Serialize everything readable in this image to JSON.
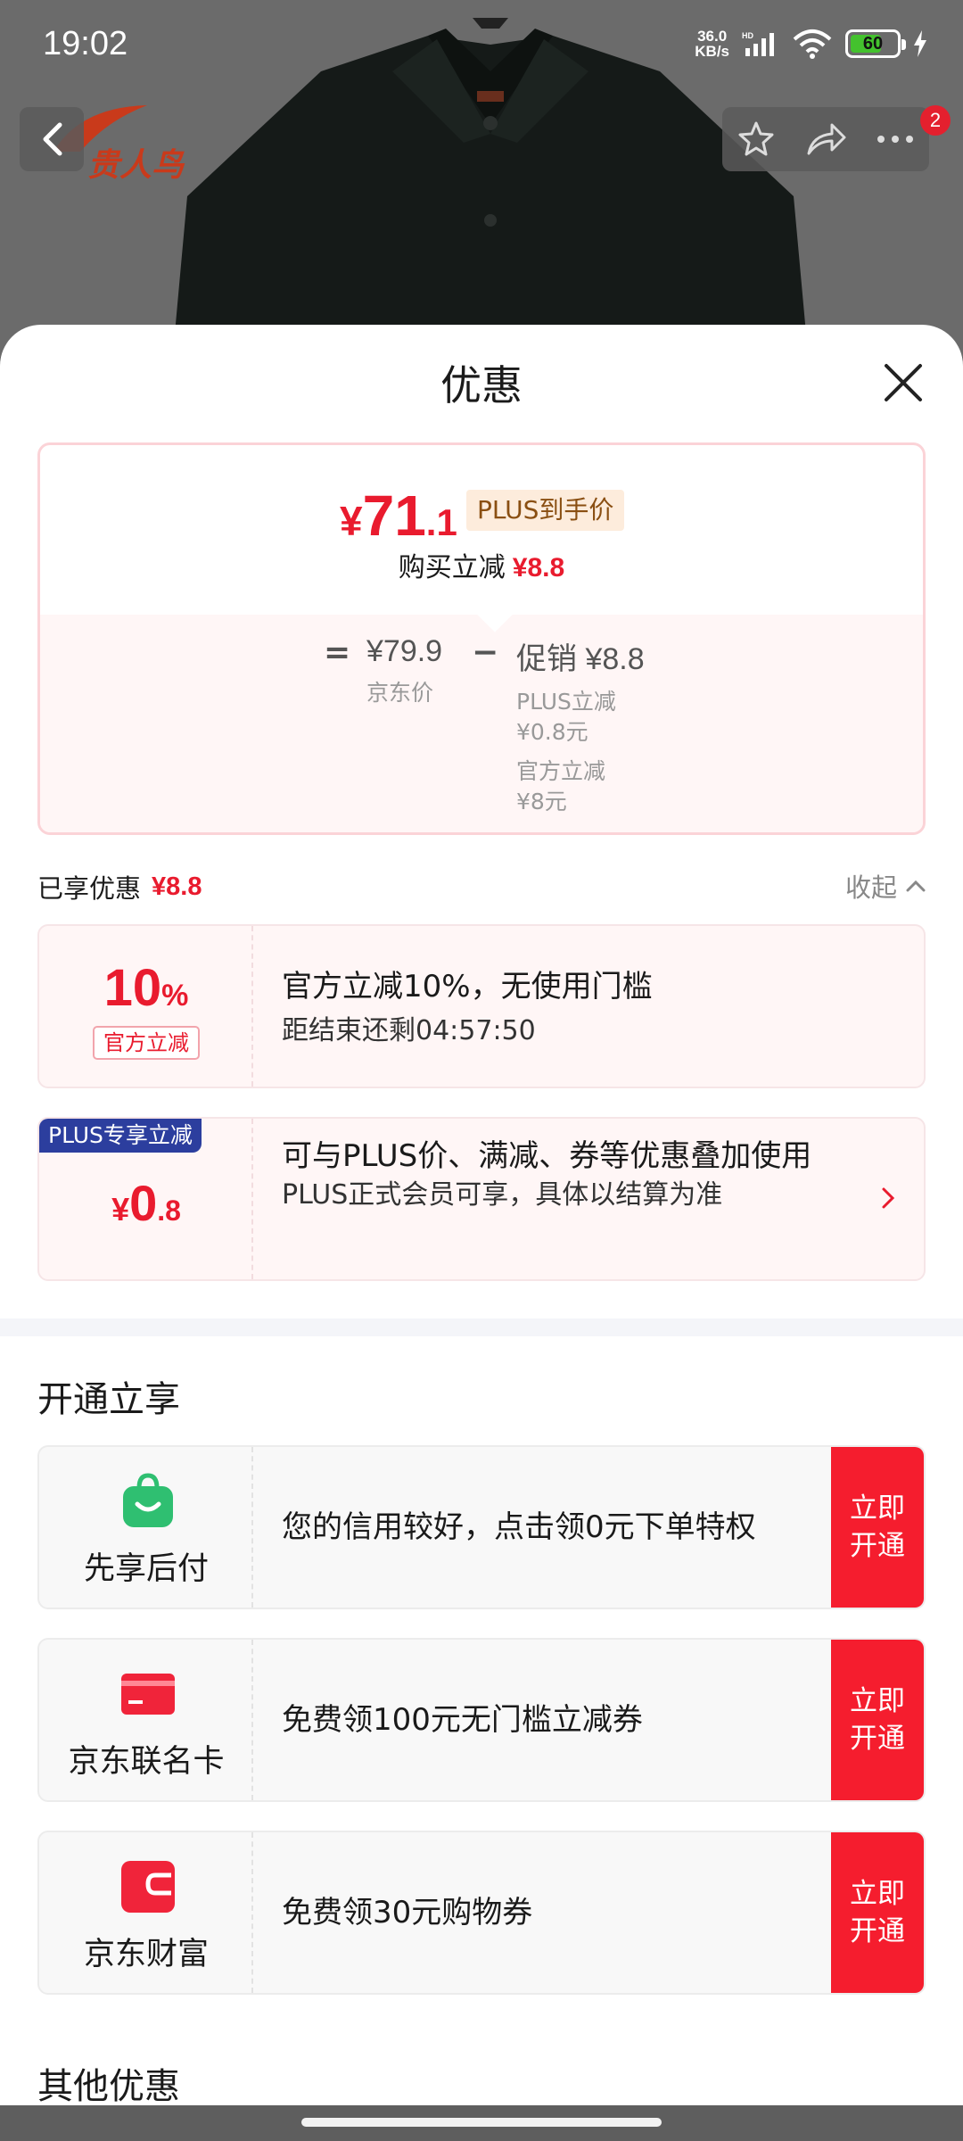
{
  "status_bar": {
    "time": "19:02",
    "net_speed_value": "36.0",
    "net_speed_unit": "KB/s",
    "hd_label": "HD",
    "battery": "60"
  },
  "product_header": {
    "brand_name": "贵人鸟",
    "cart_badge": "2"
  },
  "sheet": {
    "title": "优惠"
  },
  "price_summary": {
    "hand_price_currency": "¥",
    "hand_price_int": "71",
    "hand_price_dec": ".1",
    "plus_tag": "PLUS到手价",
    "instant_label": "购买立减",
    "instant_value": "¥8.8",
    "equals": "=",
    "jd_price": "¥79.9",
    "jd_price_label": "京东价",
    "minus": "−",
    "promo_label": "促销",
    "promo_value": "¥8.8",
    "promo_items": [
      {
        "name": "PLUS立减",
        "value": "¥0.8元"
      },
      {
        "name": "官方立减",
        "value": "¥8元"
      }
    ]
  },
  "enjoyed": {
    "label": "已享优惠",
    "value": "¥8.8",
    "collapse_label": "收起"
  },
  "coupons": [
    {
      "percent_num": "10",
      "percent_sym": "%",
      "tag": "官方立减",
      "title": "官方立减10%，无使用门槛",
      "subtitle": "距结束还剩04:57:50"
    },
    {
      "corner_tag": "PLUS专享立减",
      "currency": "¥",
      "int": "0",
      "dec": ".8",
      "title": "可与PLUS价、满减、券等优惠叠加使用",
      "subtitle": "PLUS正式会员可享，具体以结算为准"
    }
  ],
  "open_section": {
    "title": "开通立享",
    "offers": [
      {
        "name": "先享后付",
        "icon": "shopping-bag-icon",
        "desc": "您的信用较好，点击领0元下单特权",
        "cta": "立即开通"
      },
      {
        "name": "京东联名卡",
        "icon": "credit-card-icon",
        "desc": "免费领100元无门槛立减券",
        "cta": "立即开通"
      },
      {
        "name": "京东财富",
        "icon": "wallet-icon",
        "desc": "免费领30元购物券",
        "cta": "立即开通"
      }
    ]
  },
  "other_section": {
    "title": "其他优惠"
  },
  "colors": {
    "accent_red": "#e91b2e",
    "cta_red": "#f51d2e",
    "plus_blue": "#2c3e9e",
    "pay_green": "#2fbf71"
  }
}
